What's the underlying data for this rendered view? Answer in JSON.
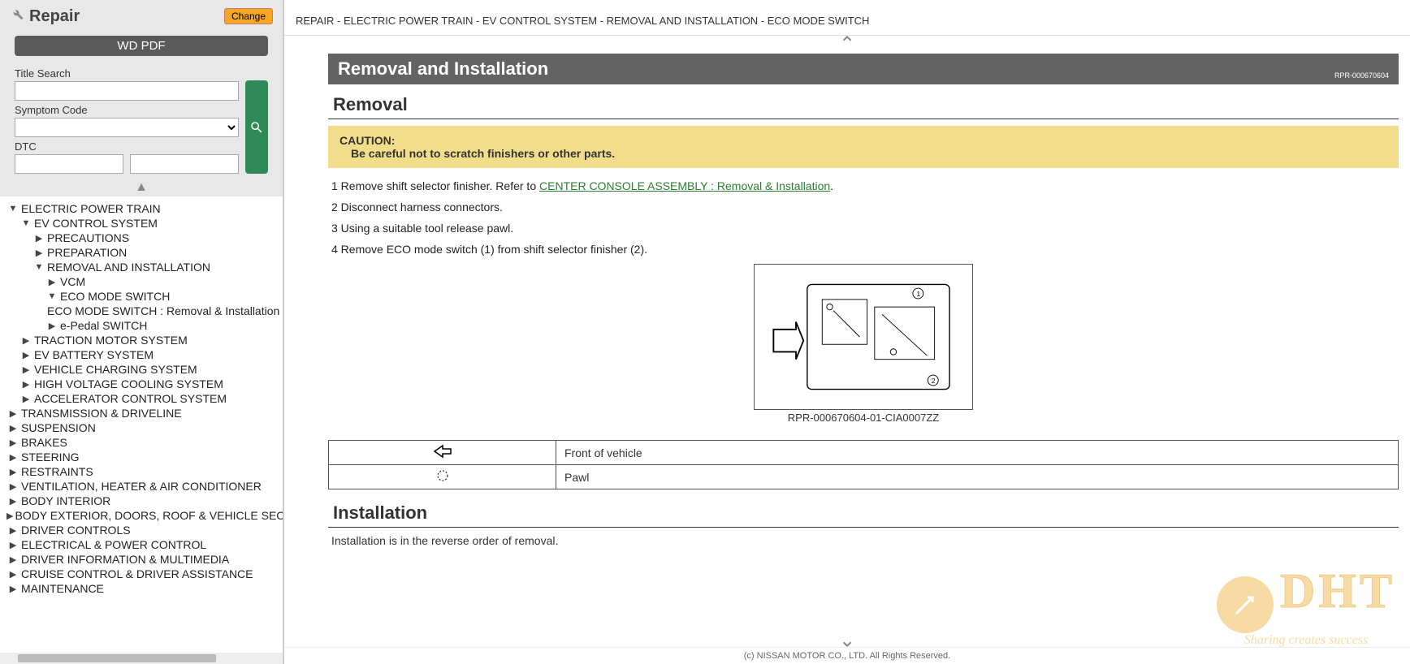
{
  "sidebar": {
    "title": "Repair",
    "change_btn": "Change",
    "wd_pdf_btn": "WD PDF",
    "labels": {
      "title_search": "Title Search",
      "symptom_code": "Symptom Code",
      "dtc": "DTC"
    }
  },
  "tree": [
    {
      "lvl": 0,
      "caret": "down",
      "label": "ELECTRIC POWER TRAIN"
    },
    {
      "lvl": 1,
      "caret": "down",
      "label": "EV CONTROL SYSTEM"
    },
    {
      "lvl": 2,
      "caret": "right",
      "label": "PRECAUTIONS"
    },
    {
      "lvl": 2,
      "caret": "right",
      "label": "PREPARATION"
    },
    {
      "lvl": 2,
      "caret": "down",
      "label": "REMOVAL AND INSTALLATION"
    },
    {
      "lvl": 3,
      "caret": "right",
      "label": "VCM"
    },
    {
      "lvl": 3,
      "caret": "down",
      "label": "ECO MODE SWITCH"
    },
    {
      "lvl": 4,
      "caret": "",
      "label": "ECO MODE SWITCH : Removal & Installation"
    },
    {
      "lvl": 3,
      "caret": "right",
      "label": "e-Pedal SWITCH"
    },
    {
      "lvl": 1,
      "caret": "right",
      "label": "TRACTION MOTOR SYSTEM"
    },
    {
      "lvl": 1,
      "caret": "right",
      "label": "EV BATTERY SYSTEM"
    },
    {
      "lvl": 1,
      "caret": "right",
      "label": "VEHICLE CHARGING SYSTEM"
    },
    {
      "lvl": 1,
      "caret": "right",
      "label": "HIGH VOLTAGE COOLING SYSTEM"
    },
    {
      "lvl": 1,
      "caret": "right",
      "label": "ACCELERATOR CONTROL SYSTEM"
    },
    {
      "lvl": 0,
      "caret": "right",
      "label": "TRANSMISSION & DRIVELINE"
    },
    {
      "lvl": 0,
      "caret": "right",
      "label": "SUSPENSION"
    },
    {
      "lvl": 0,
      "caret": "right",
      "label": "BRAKES"
    },
    {
      "lvl": 0,
      "caret": "right",
      "label": "STEERING"
    },
    {
      "lvl": 0,
      "caret": "right",
      "label": "RESTRAINTS"
    },
    {
      "lvl": 0,
      "caret": "right",
      "label": "VENTILATION, HEATER & AIR CONDITIONER"
    },
    {
      "lvl": 0,
      "caret": "right",
      "label": "BODY INTERIOR"
    },
    {
      "lvl": 0,
      "caret": "right",
      "label": "BODY EXTERIOR, DOORS, ROOF & VEHICLE SECURITY"
    },
    {
      "lvl": 0,
      "caret": "right",
      "label": "DRIVER CONTROLS"
    },
    {
      "lvl": 0,
      "caret": "right",
      "label": "ELECTRICAL & POWER CONTROL"
    },
    {
      "lvl": 0,
      "caret": "right",
      "label": "DRIVER INFORMATION & MULTIMEDIA"
    },
    {
      "lvl": 0,
      "caret": "right",
      "label": "CRUISE CONTROL & DRIVER ASSISTANCE"
    },
    {
      "lvl": 0,
      "caret": "right",
      "label": "MAINTENANCE"
    }
  ],
  "breadcrumb": "REPAIR - ELECTRIC POWER TRAIN - EV CONTROL SYSTEM - REMOVAL AND INSTALLATION - ECO MODE SWITCH",
  "content": {
    "section_title": "Removal and Installation",
    "section_ref": "RPR-000670604",
    "removal_heading": "Removal",
    "caution_label": "CAUTION:",
    "caution_text": "Be careful not to scratch finishers or other parts.",
    "steps": [
      {
        "num": "1",
        "text_before": "Remove shift selector finisher. Refer to ",
        "link": "CENTER CONSOLE ASSEMBLY : Removal & Installation",
        "text_after": "."
      },
      {
        "num": "2",
        "text_before": "Disconnect harness connectors.",
        "link": "",
        "text_after": ""
      },
      {
        "num": "3",
        "text_before": "Using a suitable tool release pawl.",
        "link": "",
        "text_after": ""
      },
      {
        "num": "4",
        "text_before": "Remove ECO mode switch (1) from shift selector finisher (2).",
        "link": "",
        "text_after": ""
      }
    ],
    "figure_caption": "RPR-000670604-01-CIA0007ZZ",
    "legend": [
      {
        "icon": "arrow-left",
        "label": "Front of vehicle"
      },
      {
        "icon": "pawl",
        "label": "Pawl"
      }
    ],
    "install_heading": "Installation",
    "install_text": "Installation is in the reverse order of removal."
  },
  "footer": "(c) NISSAN MOTOR CO., LTD. All Rights Reserved.",
  "watermark": {
    "big": "DHT",
    "small": "Sharing creates success"
  }
}
